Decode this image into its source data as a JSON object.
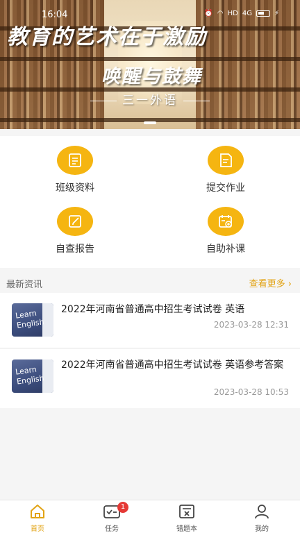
{
  "status_bar": {
    "time": "16:04",
    "network": "HD",
    "signal": "4G"
  },
  "banner": {
    "title": "教育的艺术在于激励",
    "subtitle": "唤醒与鼓舞",
    "school": "三一外语"
  },
  "quick_menu": [
    {
      "label": "班级资料",
      "icon": "document-icon"
    },
    {
      "label": "提交作业",
      "icon": "submit-file-icon"
    },
    {
      "label": "自查报告",
      "icon": "edit-report-icon"
    },
    {
      "label": "自助补课",
      "icon": "calendar-add-icon"
    }
  ],
  "news": {
    "header": "最新资讯",
    "more_label": "查看更多",
    "items": [
      {
        "title": "2022年河南省普通高中招生考试试卷 英语",
        "date": "2023-03-28 12:31",
        "thumb_text": "Learn English"
      },
      {
        "title": "2022年河南省普通高中招生考试试卷 英语参考答案",
        "date": "2023-03-28 10:53",
        "thumb_text": "Learn English"
      }
    ]
  },
  "tabbar": {
    "tabs": [
      {
        "label": "首页",
        "icon": "home-icon"
      },
      {
        "label": "任务",
        "icon": "task-icon",
        "badge": "1"
      },
      {
        "label": "错题本",
        "icon": "wrong-book-icon"
      },
      {
        "label": "我的",
        "icon": "profile-icon"
      }
    ]
  },
  "colors": {
    "accent": "#f5b511",
    "accent_text": "#e2a313",
    "badge": "#e53935"
  }
}
